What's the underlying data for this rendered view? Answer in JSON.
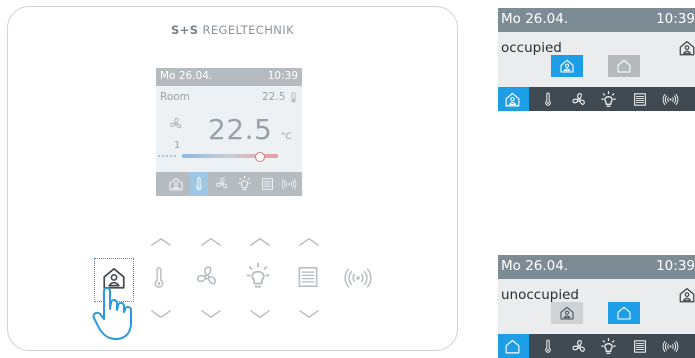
{
  "device": {
    "brand_symbol": "S+S",
    "brand_name": "REGELTECHNIK",
    "display": {
      "date": "Mo 26.04.",
      "time": "10:39",
      "room_label": "Room",
      "setpoint": "22.5",
      "temperature": "22.5",
      "unit": "°C",
      "fan_level": "1",
      "active_tab": "temperature",
      "bottom_icons": [
        "presence-icon",
        "thermometer-icon",
        "fan-icon",
        "light-icon",
        "blind-icon",
        "wireless-icon"
      ]
    },
    "keypad": {
      "icons": [
        "presence-icon",
        "thermometer-icon",
        "fan-icon",
        "light-icon",
        "blind-icon",
        "wireless-icon"
      ],
      "selected": "presence-icon"
    }
  },
  "screens": [
    {
      "date": "Mo 26.04.",
      "time": "10:39",
      "mode_label": "occupied",
      "active_choice": "occupied",
      "nav_icons": [
        "presence-icon",
        "thermometer-icon",
        "fan-icon",
        "light-icon",
        "blind-icon",
        "wireless-icon"
      ]
    },
    {
      "date": "Mo 26.04.",
      "time": "10:39",
      "mode_label": "unoccupied",
      "active_choice": "unoccupied",
      "nav_icons": [
        "house-icon",
        "thermometer-icon",
        "fan-icon",
        "light-icon",
        "blind-icon",
        "wireless-icon"
      ]
    }
  ],
  "colors": {
    "accent": "#1f9ee8",
    "screen_header": "#7d8b94",
    "screen_nav": "#3f4a52",
    "device_border": "#cfd2d6",
    "device_icons": "#b9bec2"
  }
}
